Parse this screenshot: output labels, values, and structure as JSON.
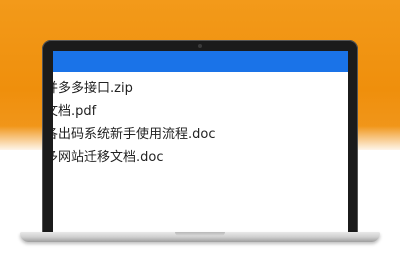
{
  "files": [
    "并多多接口.zip",
    "文档.pdf",
    "各出码系统新手使用流程.doc",
    "多网站迁移文档.doc"
  ],
  "colors": {
    "background_orange": "#f0900f",
    "title_bar_blue": "#1a73e8",
    "bezel": "#1b1b1b"
  }
}
